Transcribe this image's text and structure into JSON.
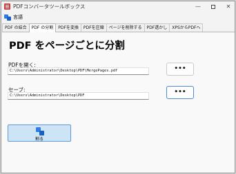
{
  "window": {
    "title": "PDFコンバータツールボックス",
    "controls": {
      "minimize": "—",
      "close": "✕"
    }
  },
  "menu": {
    "language_label": "言語"
  },
  "tabs": [
    {
      "label": "PDF の結合",
      "active": false
    },
    {
      "label": "PDF の分割",
      "active": true
    },
    {
      "label": "PDFを変換",
      "active": false
    },
    {
      "label": "PDFを圧縮",
      "active": false
    },
    {
      "label": "ページを削除する",
      "active": false
    },
    {
      "label": "PDF透かし",
      "active": false
    },
    {
      "label": "XPSからPDFへ",
      "active": false
    }
  ],
  "split_page": {
    "title": "PDF をページごとに分割",
    "open_label": "PDFを開く:",
    "open_path": "C:\\Users\\Administrator\\Desktop\\PDF\\MergePages.pdf",
    "save_label": "セーブ:",
    "save_path": "C:\\Users\\Administrator\\Desktop\\PDF",
    "browse_label": "•••",
    "split_button_label": "割る"
  },
  "colors": {
    "accent": "#2b7de9",
    "split_button_bg": "#cde3f6",
    "split_button_border": "#5d9ad8"
  }
}
